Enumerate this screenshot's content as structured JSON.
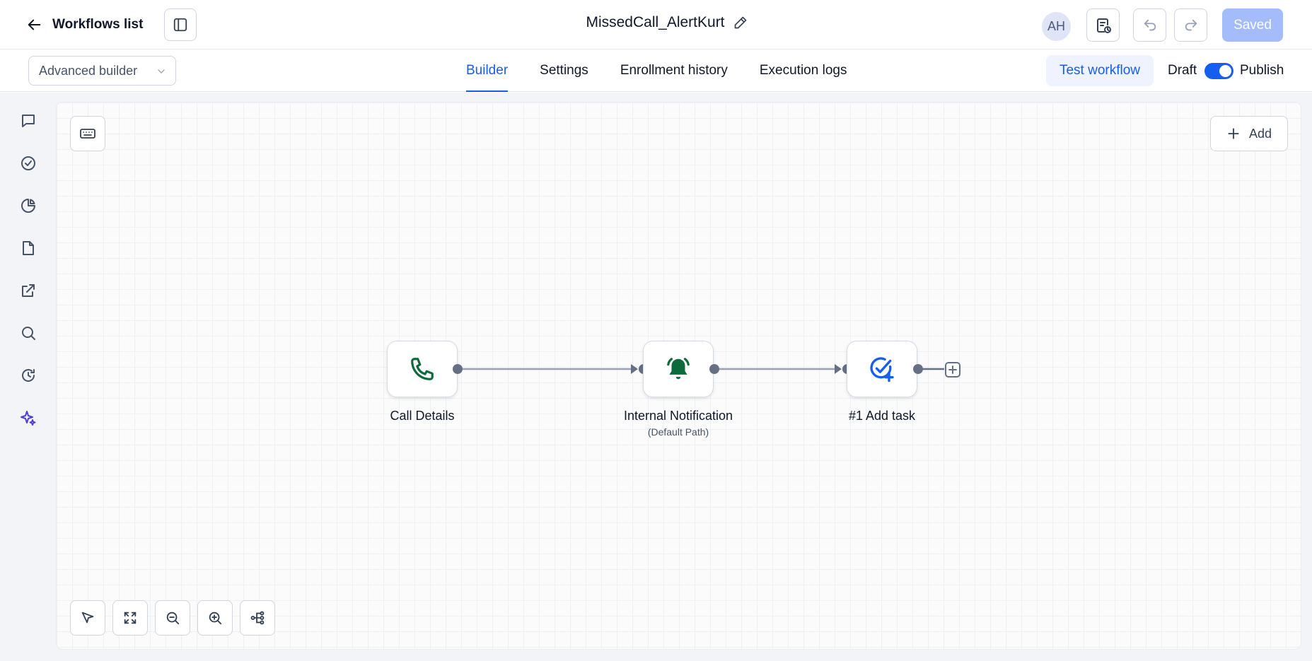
{
  "header": {
    "back_label": "Workflows list",
    "workflow_name": "MissedCall_AlertKurt",
    "avatar_initials": "AH",
    "saved_label": "Saved"
  },
  "subbar": {
    "builder_mode": "Advanced builder",
    "tabs": [
      {
        "label": "Builder",
        "active": true
      },
      {
        "label": "Settings",
        "active": false
      },
      {
        "label": "Enrollment history",
        "active": false
      },
      {
        "label": "Execution logs",
        "active": false
      }
    ],
    "test_label": "Test workflow",
    "draft_label": "Draft",
    "publish_label": "Publish",
    "publish_toggle_on": true
  },
  "rail": {
    "items": [
      {
        "icon": "chat-icon"
      },
      {
        "icon": "check-circle-icon"
      },
      {
        "icon": "pie-chart-icon"
      },
      {
        "icon": "file-icon"
      },
      {
        "icon": "external-link-icon"
      },
      {
        "icon": "search-icon"
      },
      {
        "icon": "history-icon"
      },
      {
        "icon": "sparkles-icon"
      }
    ]
  },
  "canvas": {
    "add_label": "Add",
    "nodes": [
      {
        "label": "Call Details",
        "sublabel": "",
        "icon": "phone-icon"
      },
      {
        "label": "Internal Notification",
        "sublabel": "(Default Path)",
        "icon": "bell-icon"
      },
      {
        "label": "#1 Add task",
        "sublabel": "",
        "icon": "task-add-icon"
      }
    ]
  },
  "colors": {
    "accent": "#155eef",
    "node_green": "#0b6b3a",
    "saved_bg": "#a4bcfb",
    "sparkle": "#4f3fd8"
  }
}
